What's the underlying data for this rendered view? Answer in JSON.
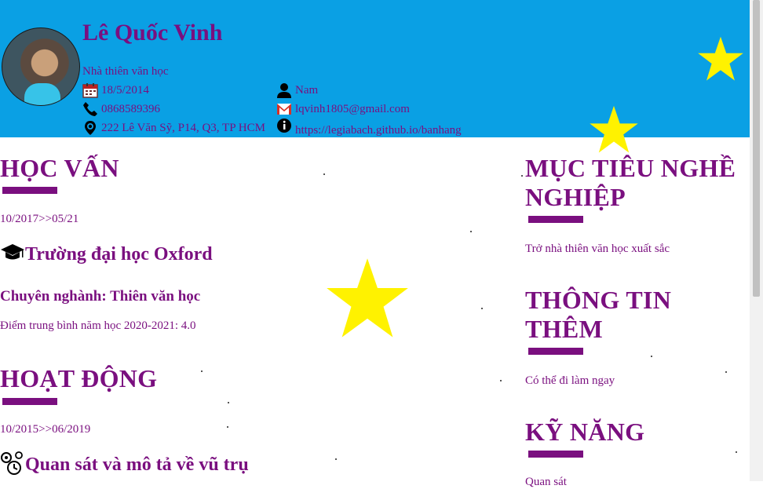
{
  "header": {
    "name": "Lê Quốc Vinh",
    "job_title": "Nhà thiên văn học",
    "birthday": "18/5/2014",
    "gender": "Nam",
    "phone": "0868589396",
    "email": "lqvinh1805@gmail.com",
    "address": "222 Lê Văn Sỹ, P14, Q3, TP HCM",
    "website": "https://legiabach.github.io/banhang"
  },
  "education": {
    "heading": "HỌC VẤN",
    "period": "10/2017>>05/21",
    "school": "Trường đại học Oxford",
    "major": "Chuyên nghành: Thiên văn học",
    "gpa": "Điểm trung bình năm học 2020-2021: 4.0"
  },
  "activities": {
    "heading": "HOẠT ĐỘNG",
    "period": "10/2015>>06/2019",
    "title": "Quan sát và mô tả về vũ trụ"
  },
  "career_goal": {
    "heading_line1": "MỤC TIÊU NGHỀ",
    "heading_line2": "NGHIỆP",
    "text": "Trở nhà thiên văn học xuất sắc"
  },
  "more_info": {
    "heading_line1": "THÔNG TIN",
    "heading_line2": "THÊM",
    "text": "Có thể đi làm ngay"
  },
  "skills": {
    "heading": "KỸ NĂNG",
    "text": "Quan sát"
  },
  "colors": {
    "header_bg": "#0aa0e4",
    "accent": "#7a0f7f",
    "star": "#fff200"
  },
  "icons": [
    "calendar-icon",
    "person-icon",
    "phone-icon",
    "gmail-icon",
    "location-icon",
    "info-icon",
    "graduation-cap-icon",
    "gears-clock-icon",
    "star-icon"
  ]
}
